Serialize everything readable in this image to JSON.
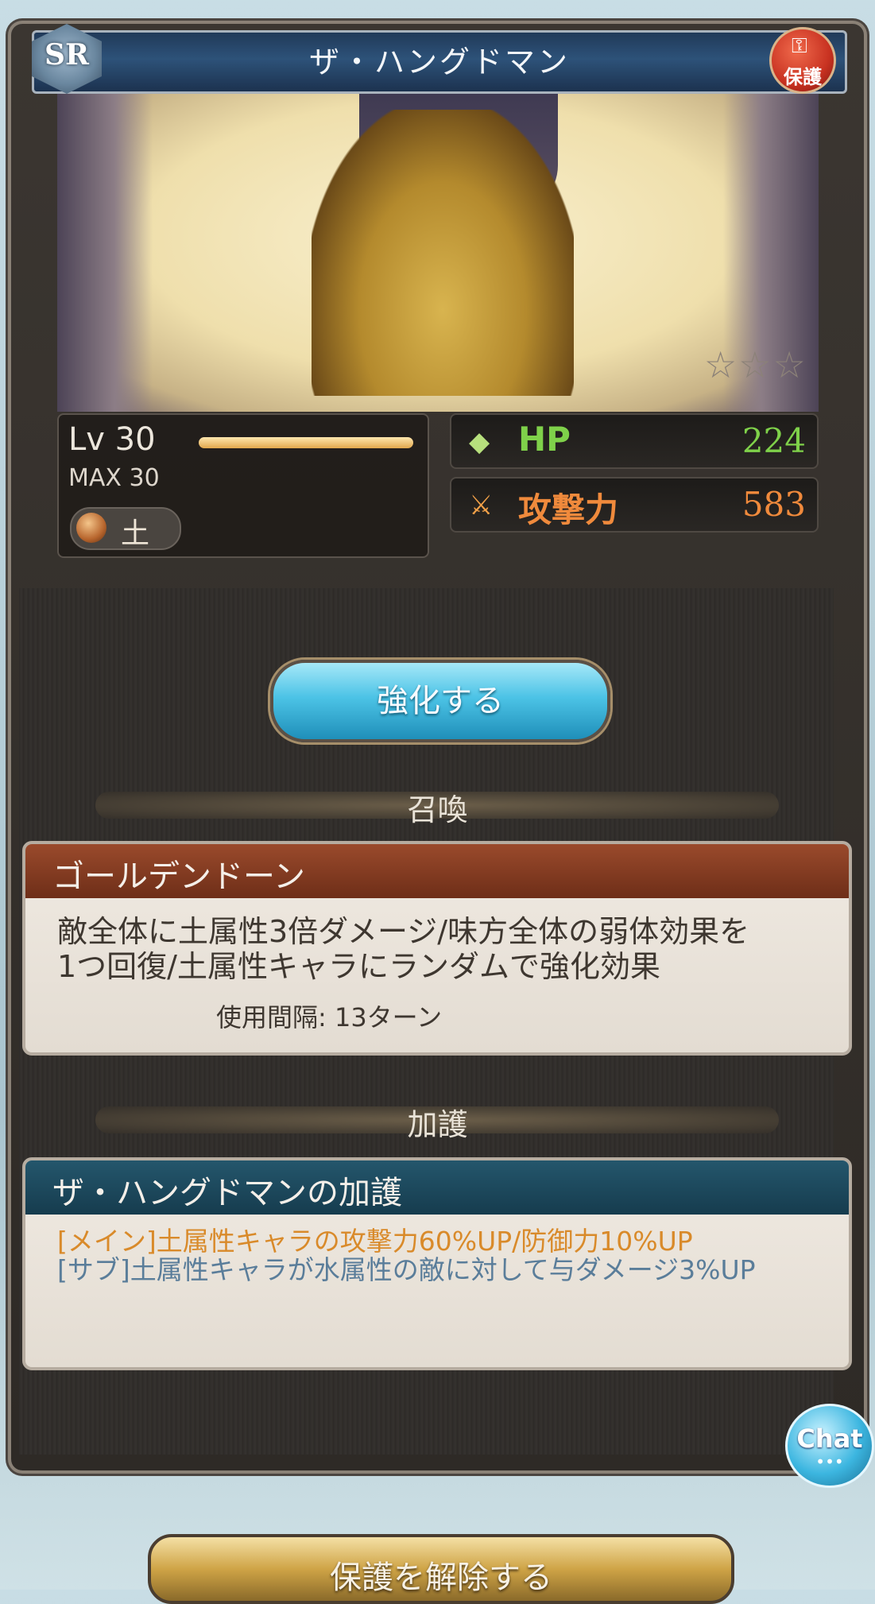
{
  "header": {
    "title": "ザ・ハングドマン",
    "rarity": "SR",
    "protect_label": "保護"
  },
  "art": {
    "rank_stars": "☆☆☆"
  },
  "level": {
    "label": "Lv 30",
    "max_label": "MAX 30",
    "progress": 1.0,
    "element": "土"
  },
  "stats": {
    "hp_label": "HP",
    "hp_value": "224",
    "atk_label": "攻撃力",
    "atk_value": "583"
  },
  "enhance_button": "強化する",
  "summon": {
    "section_title": "召喚",
    "name": "ゴールデンドーン",
    "description_line1": "敵全体に土属性3倍ダメージ/味方全体の弱体効果を",
    "description_line2": "1つ回復/土属性キャラにランダムで強化効果",
    "cooldown": "使用間隔: 13ターン"
  },
  "aura": {
    "section_title": "加護",
    "name": "ザ・ハングドマンの加護",
    "main": "[メイン]土属性キャラの攻撃力60%UP/防御力10%UP",
    "sub": "[サブ]土属性キャラが水属性の敵に対して与ダメージ3%UP"
  },
  "chat_button": "Chat",
  "release_button": "保護を解除する",
  "colors": {
    "hp": "#7fd14a",
    "atk": "#f08a3c",
    "aura_main": "#d98a2a",
    "aura_sub": "#5a7d9a",
    "summon_header": "#8b3e24",
    "aura_header": "#1f4a5e"
  }
}
